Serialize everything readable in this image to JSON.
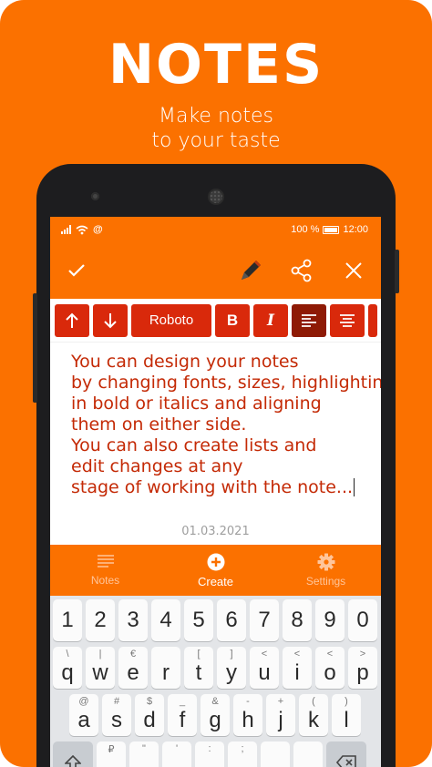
{
  "promo": {
    "title": "NOTES",
    "subtitle_line1": "Make notes",
    "subtitle_line2": "to your taste",
    "background": "#fb7100"
  },
  "status_bar": {
    "battery": "100 %",
    "time": "12:00",
    "left_icons": [
      "signal-icon",
      "wifi-icon",
      "at-icon"
    ]
  },
  "toolbar": {
    "icons": [
      "check-icon",
      "pencil-icon",
      "share-icon",
      "close-icon"
    ]
  },
  "format_bar": {
    "font_label": "Roboto",
    "bold_label": "B",
    "italic_label": "I",
    "accent": "#d9290b",
    "active": "#8e1a05"
  },
  "note": {
    "lines": [
      "You can design your notes",
      "by changing fonts, sizes, highlighting",
      "in bold or italics and aligning",
      "them on either side.",
      "You can also create lists and",
      "edit changes at any",
      "stage of working with the note..."
    ],
    "date": "01.03.2021",
    "text_color": "#c42a06"
  },
  "bottom_nav": {
    "items": [
      {
        "label": "Notes",
        "icon": "list-icon"
      },
      {
        "label": "Create",
        "icon": "plus-circle-icon"
      },
      {
        "label": "Settings",
        "icon": "gear-icon"
      }
    ]
  },
  "keyboard": {
    "numbers": [
      "1",
      "2",
      "3",
      "4",
      "5",
      "6",
      "7",
      "8",
      "9",
      "0"
    ],
    "row1": [
      {
        "key": "q",
        "alt": "\\"
      },
      {
        "key": "w",
        "alt": "|"
      },
      {
        "key": "e",
        "alt": "€"
      },
      {
        "key": "r",
        "alt": ""
      },
      {
        "key": "t",
        "alt": "["
      },
      {
        "key": "y",
        "alt": "]"
      },
      {
        "key": "u",
        "alt": "<"
      },
      {
        "key": "i",
        "alt": "<"
      },
      {
        "key": "o",
        "alt": "<"
      },
      {
        "key": "p",
        "alt": ">"
      }
    ],
    "row2": [
      {
        "key": "a",
        "alt": "@"
      },
      {
        "key": "s",
        "alt": "#"
      },
      {
        "key": "d",
        "alt": "$"
      },
      {
        "key": "f",
        "alt": "_"
      },
      {
        "key": "g",
        "alt": "&"
      },
      {
        "key": "h",
        "alt": "-"
      },
      {
        "key": "j",
        "alt": "+"
      },
      {
        "key": "k",
        "alt": "("
      },
      {
        "key": "l",
        "alt": ")"
      }
    ],
    "row3_alts": [
      "₽",
      "\"",
      "'",
      ":",
      ";"
    ]
  }
}
